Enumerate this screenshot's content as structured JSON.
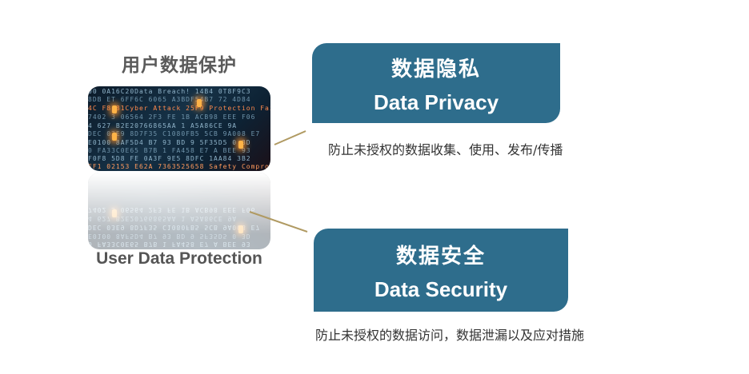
{
  "left_panel": {
    "title": "用户数据保护",
    "caption": "User Data Protection"
  },
  "image_code_text": [
    "00 0A16C20Data Breach! 14B4 0T8F9C3",
    "8DB ET 6FF6C 6065 A3BDF54B7 72 4D84",
    "4C F8 81Cyber Attack 25F9 Protection Failed",
    "7402 3 06564 2F3 FE 1B ACB98 EEE F06",
    "4 627 B2E20766865AA 1 A5A86CE 9A",
    "DEC 03E9 8D7F35 C1080FB5 5CB 9A008 E7",
    "E0100 8AF5D4 B7 93 BD 9 5F35D5 0 3D",
    "0 FA33C0E65 B7B 1 FA458 E7 A BEE 93",
    "F0F8 5D8 FE 0A3F 9E5 8DFC 1AA84 3B2",
    "EF1 02153 E62A 7363525658 Safety Compromised"
  ],
  "cards": {
    "privacy": {
      "title_cn": "数据隐私",
      "title_en": "Data Privacy",
      "description": "防止未授权的数据收集、使用、发布/传播"
    },
    "security": {
      "title_cn": "数据安全",
      "title_en": "Data Security",
      "description": "防止未授权的数据访问，数据泄漏以及应对措施"
    }
  },
  "colors": {
    "card_fill": "#2e6d8c",
    "connector": "#b09a62",
    "title_text": "#5a5a5a",
    "body_text": "#333333"
  }
}
